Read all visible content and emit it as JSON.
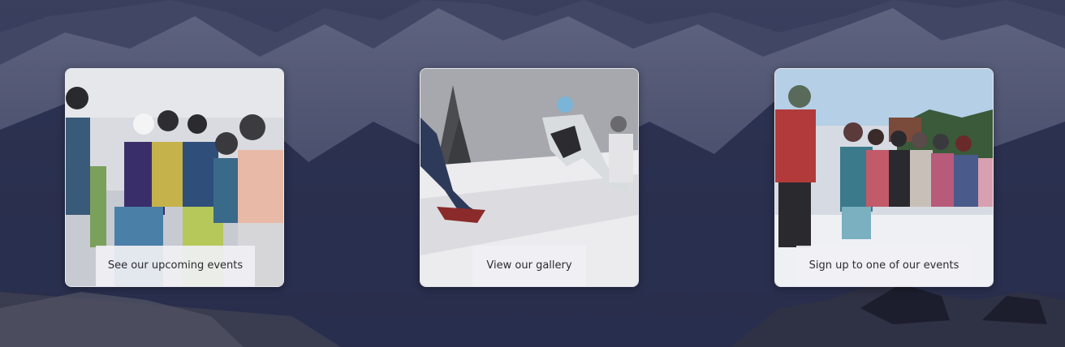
{
  "background": {
    "description_icon": "mountain-landscape",
    "overlay_color": "#1e2246"
  },
  "cards": [
    {
      "label": "See our upcoming events",
      "icon": "ski-group-photo"
    },
    {
      "label": "View our gallery",
      "icon": "ski-racers-photo"
    },
    {
      "label": "Sign up to one of our events",
      "icon": "ski-kids-group-photo"
    }
  ]
}
